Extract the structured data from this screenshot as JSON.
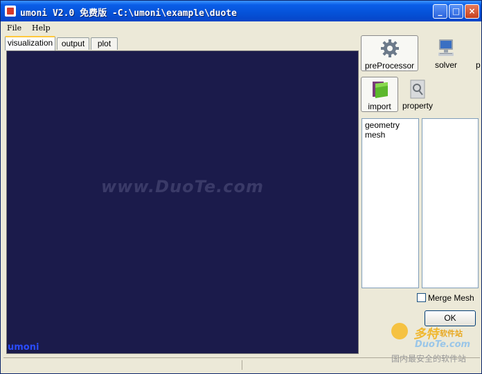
{
  "window": {
    "title": "umoni V2.0 免费版  -C:\\umoni\\example\\duote",
    "minimize": "_",
    "maximize": "□",
    "close": "×"
  },
  "menu": {
    "file": "File",
    "help": "Help"
  },
  "tabs": [
    {
      "label": "visualization",
      "active": true
    },
    {
      "label": "output",
      "active": false
    },
    {
      "label": "plot",
      "active": false
    }
  ],
  "viewport": {
    "background": "#1b1b4b",
    "watermark": "www.DuoTe.com",
    "corner_label": "umoni"
  },
  "toolbar": {
    "preprocessor": "preProcessor",
    "solver": "solver",
    "overflow": "p"
  },
  "subtoolbar": {
    "import": "import",
    "property": "property"
  },
  "left_list": {
    "items": [
      "geometry",
      "mesh"
    ]
  },
  "right_list": {
    "items": []
  },
  "merge_mesh": {
    "label": "Merge Mesh",
    "checked": false
  },
  "ok_button": "OK",
  "brand": {
    "main": "多特",
    "sub": "软件站",
    "url": "DuoTe.com",
    "slogan": "国内最安全的软件站"
  }
}
